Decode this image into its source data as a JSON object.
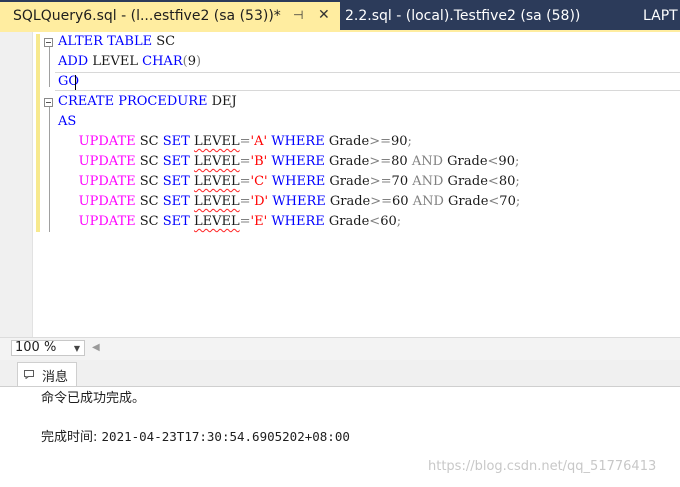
{
  "tabs": [
    {
      "label": "SQLQuery6.sql - (l...estfive2 (sa (53))*",
      "active": true,
      "pin_icon": "pin-icon",
      "close_icon": "close-icon"
    },
    {
      "label": "2.2.sql - (local).Testfive2 (sa (58))",
      "active": false
    },
    {
      "label": "LAPT",
      "active": false
    }
  ],
  "tab_pin_glyph": "⊣",
  "tab_close_glyph": "✕",
  "editor": {
    "lines": [
      [
        {
          "t": "ALTER",
          "c": "kw"
        },
        {
          "t": " "
        },
        {
          "t": "TABLE",
          "c": "kw"
        },
        {
          "t": " SC",
          "c": "ident"
        }
      ],
      [
        {
          "t": "ADD",
          "c": "kw"
        },
        {
          "t": " LEVEL ",
          "c": "ident"
        },
        {
          "t": "CHAR",
          "c": "kw"
        },
        {
          "t": "(",
          "c": "op"
        },
        {
          "t": "9",
          "c": "ident"
        },
        {
          "t": ")",
          "c": "op"
        }
      ],
      [
        {
          "t": "GO",
          "c": "kw"
        }
      ],
      [
        {
          "t": "CREATE",
          "c": "kw"
        },
        {
          "t": " "
        },
        {
          "t": "PROCEDURE",
          "c": "kw"
        },
        {
          "t": " DEJ",
          "c": "ident"
        }
      ],
      [
        {
          "t": "AS",
          "c": "kw"
        }
      ],
      [
        {
          "t": "     "
        },
        {
          "t": "UPDATE",
          "c": "fn"
        },
        {
          "t": " SC ",
          "c": "ident"
        },
        {
          "t": "SET",
          "c": "kw"
        },
        {
          "t": " "
        },
        {
          "t": "LEVEL",
          "c": "ident squiggle"
        },
        {
          "t": "=",
          "c": "op"
        },
        {
          "t": "'A'",
          "c": "str"
        },
        {
          "t": " "
        },
        {
          "t": "WHERE",
          "c": "kw"
        },
        {
          "t": " Grade",
          "c": "ident"
        },
        {
          "t": ">=",
          "c": "op"
        },
        {
          "t": "90",
          "c": "ident"
        },
        {
          "t": ";",
          "c": "op"
        }
      ],
      [
        {
          "t": "     "
        },
        {
          "t": "UPDATE",
          "c": "fn"
        },
        {
          "t": " SC ",
          "c": "ident"
        },
        {
          "t": "SET",
          "c": "kw"
        },
        {
          "t": " "
        },
        {
          "t": "LEVEL",
          "c": "ident squiggle"
        },
        {
          "t": "=",
          "c": "op"
        },
        {
          "t": "'B'",
          "c": "str"
        },
        {
          "t": " "
        },
        {
          "t": "WHERE",
          "c": "kw"
        },
        {
          "t": " Grade",
          "c": "ident"
        },
        {
          "t": ">=",
          "c": "op"
        },
        {
          "t": "80 ",
          "c": "ident"
        },
        {
          "t": "AND",
          "c": "op"
        },
        {
          "t": " Grade",
          "c": "ident"
        },
        {
          "t": "<",
          "c": "op"
        },
        {
          "t": "90",
          "c": "ident"
        },
        {
          "t": ";",
          "c": "op"
        }
      ],
      [
        {
          "t": "     "
        },
        {
          "t": "UPDATE",
          "c": "fn"
        },
        {
          "t": " SC ",
          "c": "ident"
        },
        {
          "t": "SET",
          "c": "kw"
        },
        {
          "t": " "
        },
        {
          "t": "LEVEL",
          "c": "ident squiggle"
        },
        {
          "t": "=",
          "c": "op"
        },
        {
          "t": "'C'",
          "c": "str"
        },
        {
          "t": " "
        },
        {
          "t": "WHERE",
          "c": "kw"
        },
        {
          "t": " Grade",
          "c": "ident"
        },
        {
          "t": ">=",
          "c": "op"
        },
        {
          "t": "70 ",
          "c": "ident"
        },
        {
          "t": "AND",
          "c": "op"
        },
        {
          "t": " Grade",
          "c": "ident"
        },
        {
          "t": "<",
          "c": "op"
        },
        {
          "t": "80",
          "c": "ident"
        },
        {
          "t": ";",
          "c": "op"
        }
      ],
      [
        {
          "t": "     "
        },
        {
          "t": "UPDATE",
          "c": "fn"
        },
        {
          "t": " SC ",
          "c": "ident"
        },
        {
          "t": "SET",
          "c": "kw"
        },
        {
          "t": " "
        },
        {
          "t": "LEVEL",
          "c": "ident squiggle"
        },
        {
          "t": "=",
          "c": "op"
        },
        {
          "t": "'D'",
          "c": "str"
        },
        {
          "t": " "
        },
        {
          "t": "WHERE",
          "c": "kw"
        },
        {
          "t": " Grade",
          "c": "ident"
        },
        {
          "t": ">=",
          "c": "op"
        },
        {
          "t": "60 ",
          "c": "ident"
        },
        {
          "t": "AND",
          "c": "op"
        },
        {
          "t": " Grade",
          "c": "ident"
        },
        {
          "t": "<",
          "c": "op"
        },
        {
          "t": "70",
          "c": "ident"
        },
        {
          "t": ";",
          "c": "op"
        }
      ],
      [
        {
          "t": "     "
        },
        {
          "t": "UPDATE",
          "c": "fn"
        },
        {
          "t": " SC ",
          "c": "ident"
        },
        {
          "t": "SET",
          "c": "kw"
        },
        {
          "t": " "
        },
        {
          "t": "LEVEL",
          "c": "ident squiggle"
        },
        {
          "t": "=",
          "c": "op"
        },
        {
          "t": "'E'",
          "c": "str"
        },
        {
          "t": " "
        },
        {
          "t": "WHERE",
          "c": "kw"
        },
        {
          "t": " Grade",
          "c": "ident"
        },
        {
          "t": "<",
          "c": "op"
        },
        {
          "t": "60",
          "c": "ident"
        },
        {
          "t": ";",
          "c": "op"
        }
      ]
    ]
  },
  "zoom": {
    "value": "100 %",
    "arrow_icon": "chevron-down-icon"
  },
  "hscroll_glyph": "◀",
  "results": {
    "tab_label": "消息",
    "tab_icon": "message-icon",
    "message": "命令已成功完成。",
    "completion_label": "完成时间:",
    "completion_time": "2021-04-23T17:30:54.6905202+08:00"
  },
  "watermark": "https://blog.csdn.net/qq_51776413",
  "colors": {
    "active_tab": "#ffeda0",
    "tabbar_bg": "#2c3b5a",
    "keyword": "#0000ff",
    "function": "#ff00ff",
    "string": "#ff0000",
    "operator": "#808080"
  }
}
